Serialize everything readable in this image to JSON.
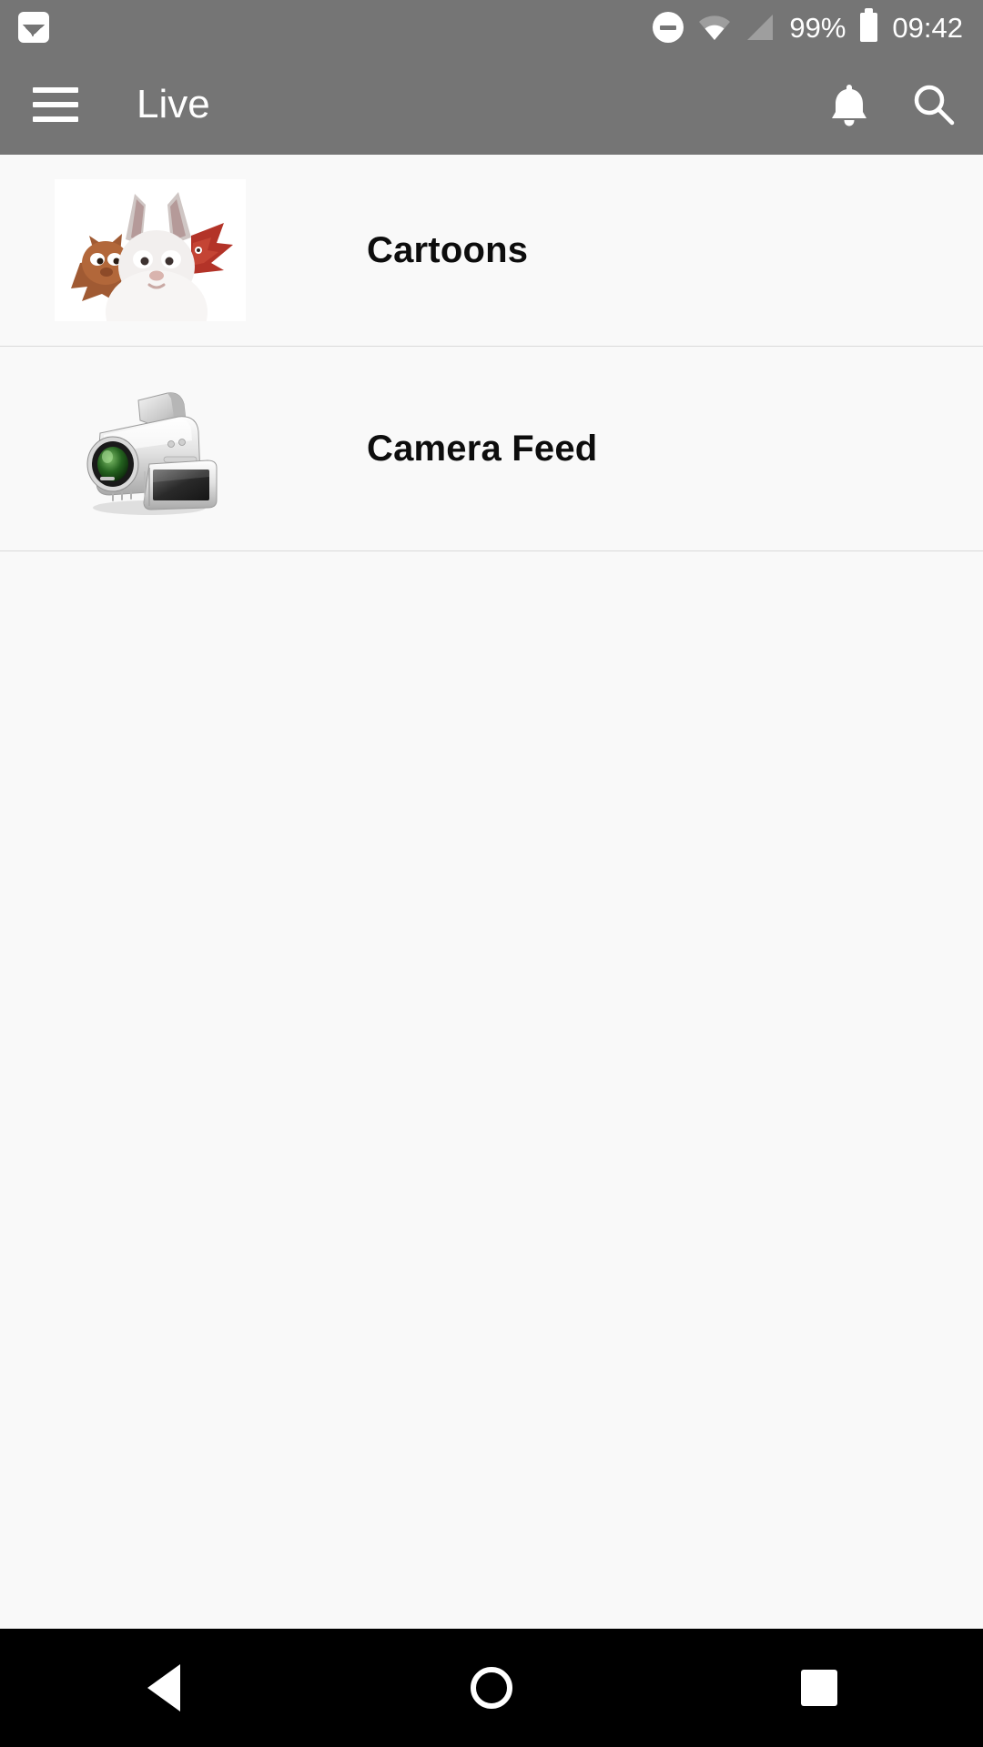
{
  "status_bar": {
    "notification_icon": "image-icon",
    "dnd_icon": "do-not-disturb-icon",
    "wifi_icon": "wifi-icon",
    "signal_icon": "cellular-signal-icon",
    "battery_percent": "99%",
    "battery_icon": "battery-full-icon",
    "time": "09:42",
    "background_color": "#757575",
    "foreground_color": "#ffffff"
  },
  "app_bar": {
    "menu_icon": "hamburger-menu-icon",
    "title": "Live",
    "notifications_icon": "bell-icon",
    "search_icon": "search-icon",
    "background_color": "#757575"
  },
  "content": {
    "background_color": "#f9f9f9",
    "items": [
      {
        "label": "Cartoons",
        "thumbnail": "big-buck-bunny-poster",
        "thumbnail_type": "image"
      },
      {
        "label": "Camera Feed",
        "thumbnail": "camcorder-icon",
        "thumbnail_type": "icon"
      }
    ]
  },
  "nav_bar": {
    "background_color": "#000000",
    "back_label": "back-button",
    "home_label": "home-button",
    "recents_label": "recents-button"
  }
}
